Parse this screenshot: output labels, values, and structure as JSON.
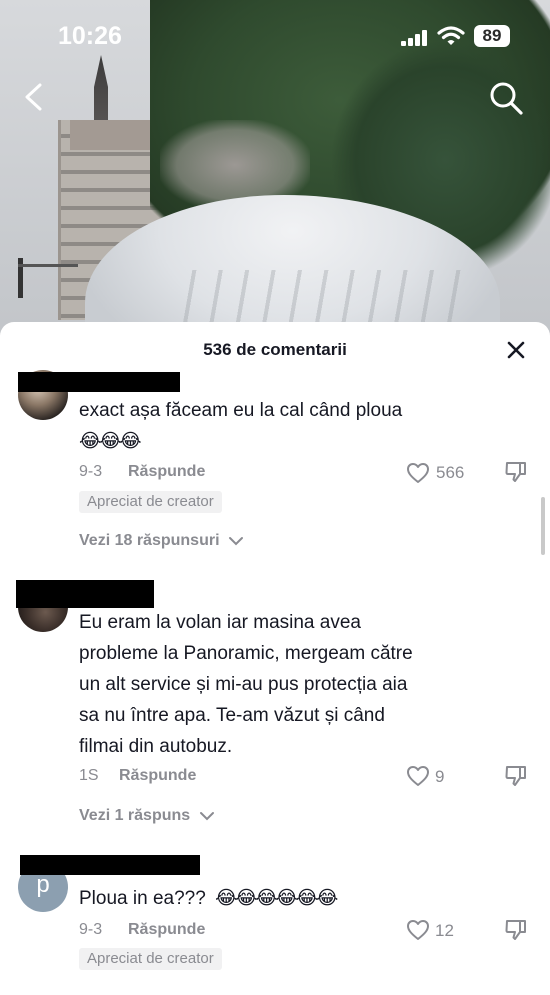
{
  "status_bar": {
    "time": "10:26",
    "battery": "89"
  },
  "comments_header": {
    "title": "536 de comentarii"
  },
  "comments": [
    {
      "text": "exact așa făceam eu la cal când ploua",
      "emoji": "😂😂😂",
      "date": "9-3",
      "reply_label": "Răspunde",
      "likes": "566",
      "creator_liked": "Apreciat de creator",
      "view_replies": "Vezi 18 răspunsuri"
    },
    {
      "text_lines": [
        "Eu eram la volan iar masina avea",
        "probleme la Panoramic, mergeam către",
        "un alt service și mi-au pus protecția aia",
        "sa nu între apa. Te-am văzut și când",
        "filmai din autobuz."
      ],
      "date": "1S",
      "reply_label": "Răspunde",
      "likes": "9",
      "view_replies": "Vezi 1 răspuns"
    },
    {
      "avatar_letter": "p",
      "text": "Ploua in ea???",
      "emoji": "😂😂😂😂😂😂",
      "date": "9-3",
      "reply_label": "Răspunde",
      "likes": "12",
      "creator_liked": "Apreciat de creator"
    }
  ],
  "icons": {
    "back": "chevron-left-icon",
    "search": "search-icon",
    "close": "close-icon",
    "like": "heart-icon",
    "dislike": "thumbs-down-icon"
  },
  "colors": {
    "text": "#161823",
    "muted": "#8a8b91",
    "badge_bg": "#f1f1f2"
  }
}
